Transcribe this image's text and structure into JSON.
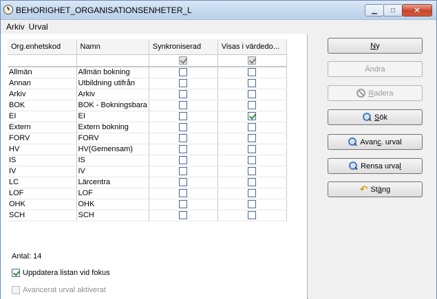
{
  "window": {
    "title": "BEHORIGHET_ORGANISATIONSENHETER_L"
  },
  "menu": [
    "Arkiv",
    "Urval"
  ],
  "table": {
    "columns": [
      "Org.enhetskod",
      "Namn",
      "Synkroniserad",
      "Visas i värdedo..."
    ],
    "filter": {
      "sync": true,
      "visas": true
    },
    "rows": [
      {
        "code": "Allmän",
        "name": "Allmän bokning",
        "sync": false,
        "visas": false
      },
      {
        "code": "Annan",
        "name": "Utbildning utifrån",
        "sync": false,
        "visas": false
      },
      {
        "code": "Arkiv",
        "name": "Arkiv",
        "sync": false,
        "visas": false
      },
      {
        "code": "BOK",
        "name": "BOK - Bokningsbara",
        "sync": false,
        "visas": false
      },
      {
        "code": "EI",
        "name": "EI",
        "sync": false,
        "visas": true
      },
      {
        "code": "Extern",
        "name": "Extern bokning",
        "sync": false,
        "visas": false
      },
      {
        "code": "FORV",
        "name": "FORV",
        "sync": false,
        "visas": false
      },
      {
        "code": "HV",
        "name": "HV(Gemensam)",
        "sync": false,
        "visas": false
      },
      {
        "code": "IS",
        "name": "IS",
        "sync": false,
        "visas": false
      },
      {
        "code": "IV",
        "name": "IV",
        "sync": false,
        "visas": false
      },
      {
        "code": "LC",
        "name": "Lärcentra",
        "sync": false,
        "visas": false
      },
      {
        "code": "LOF",
        "name": "LOF",
        "sync": false,
        "visas": false
      },
      {
        "code": "OHK",
        "name": "OHK",
        "sync": false,
        "visas": false
      },
      {
        "code": "SCH",
        "name": "SCH",
        "sync": false,
        "visas": false
      }
    ]
  },
  "count_label": "Antal: 14",
  "options": {
    "update_on_focus": {
      "label": "Uppdatera listan vid fokus",
      "checked": true
    },
    "advanced_active": {
      "label": "Avancerat urval aktiverat",
      "checked": false
    }
  },
  "buttons": {
    "new": {
      "pre": "",
      "key": "N",
      "post": "y"
    },
    "edit": {
      "label": "Ändra"
    },
    "delete": {
      "pre": "",
      "key": "R",
      "post": "adera"
    },
    "search": {
      "pre": "",
      "key": "S",
      "post": "ök"
    },
    "advanced": {
      "pre": "Avan",
      "key": "c",
      "post": ". urval"
    },
    "clear": {
      "pre": "Rensa urva",
      "key": "l",
      "post": ""
    },
    "close": {
      "pre": "St",
      "key": "ä",
      "post": "ng"
    }
  }
}
